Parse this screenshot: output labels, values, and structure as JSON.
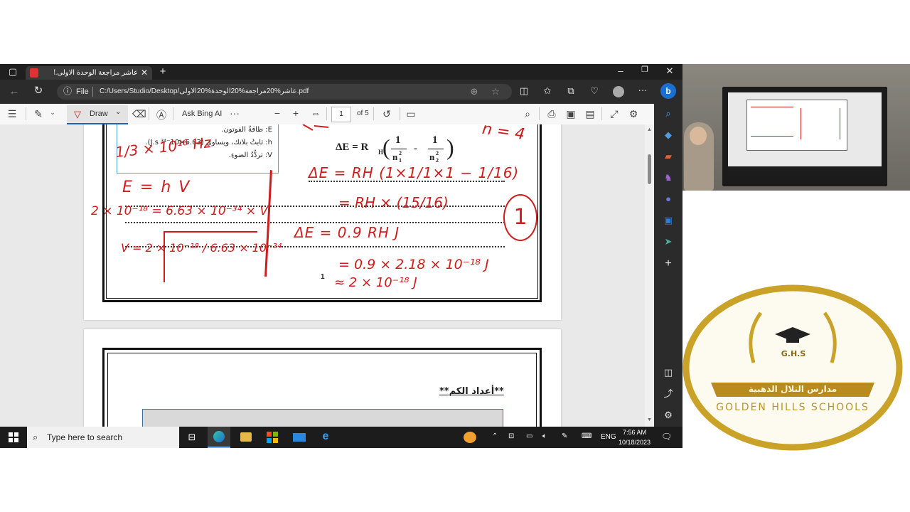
{
  "browser": {
    "tab_title": "عاشر مراجعة الوحدة الاولى.pdf*",
    "url_prefix": "File",
    "url": "C:/Users/Studio/Desktop/عاشر%20مراجعة%20الوحدة%20الاولى.pdf"
  },
  "pdf_toolbar": {
    "draw_label": "Draw",
    "ask_bing_label": "Ask Bing AI",
    "page_number": "1",
    "page_total": "of 5"
  },
  "page1": {
    "legend_e": "E: طاقةُ الفوتون.",
    "legend_h": "h: ثابتُ بلانك، ويساوي (6.63×10⁻³⁴ J.s).",
    "legend_v": "V: تردُّدُ الضوءِ.",
    "formula_lhs": "ΔE = R",
    "formula_sub": "H",
    "frac_num": "1",
    "frac_den1": "n",
    "frac_den_sub1": "1",
    "frac_den_sup": "2",
    "frac_den2": "n",
    "frac_den_sub2": "2",
    "minus": "-",
    "page_num": "1",
    "hw_n4": "n = 4",
    "hw_top": "ΔE = RH (1×1/1×1 − 1/16)",
    "hw_line2": "= RH × (15/16)",
    "hw_line3": "ΔE = 0.9 RH J",
    "hw_line4": "= 0.9 × 2.18 × 10⁻¹⁸ J",
    "hw_line5": "≈ 2 × 10⁻¹⁸ J",
    "hw_circle": "1",
    "hw_left1": "1/3 × 10¹⁶ Hz",
    "hw_left2": "E = h V",
    "hw_left3": "2 × 10⁻¹⁸ = 6.63 × 10⁻³⁴ × V",
    "hw_left4": "V = 2 × 10⁻¹⁸ / 6.63 × 10⁻³⁴"
  },
  "page2": {
    "heading": "**أعداد الكم**"
  },
  "taskbar": {
    "search_placeholder": "Type here to search",
    "lang": "ENG",
    "time": "7:56 AM",
    "date": "10/18/2023"
  },
  "logo": {
    "initials": "G.H.S",
    "arabic_name": "مدارس التلال الذهبية",
    "english_name": "GOLDEN HILLS SCHOOLS"
  },
  "colors": {
    "ink": "#d01c1c",
    "gold": "#c9a227",
    "taskbar": "#1c1c1c",
    "edge_dark": "#2b2b2b"
  },
  "icons": [
    "sidebar-toggle-icon",
    "pdf-icon",
    "close-icon",
    "plus-icon",
    "back-icon",
    "refresh-icon",
    "info-icon",
    "zoom-icon",
    "star-icon",
    "split-icon",
    "favorites-icon",
    "collections-icon",
    "extensions-icon",
    "profile-icon",
    "more-icon",
    "bing-icon",
    "toc-icon",
    "highlight-icon",
    "draw-icon",
    "eraser-icon",
    "read-aloud-icon",
    "rotate-icon",
    "page-view-icon",
    "search-icon",
    "print-icon",
    "save-icon",
    "save-as-icon",
    "fullscreen-icon",
    "settings-icon",
    "windows-icon",
    "taskview-icon",
    "edge-icon",
    "explorer-icon",
    "store-icon",
    "mail-icon",
    "ie-icon"
  ]
}
